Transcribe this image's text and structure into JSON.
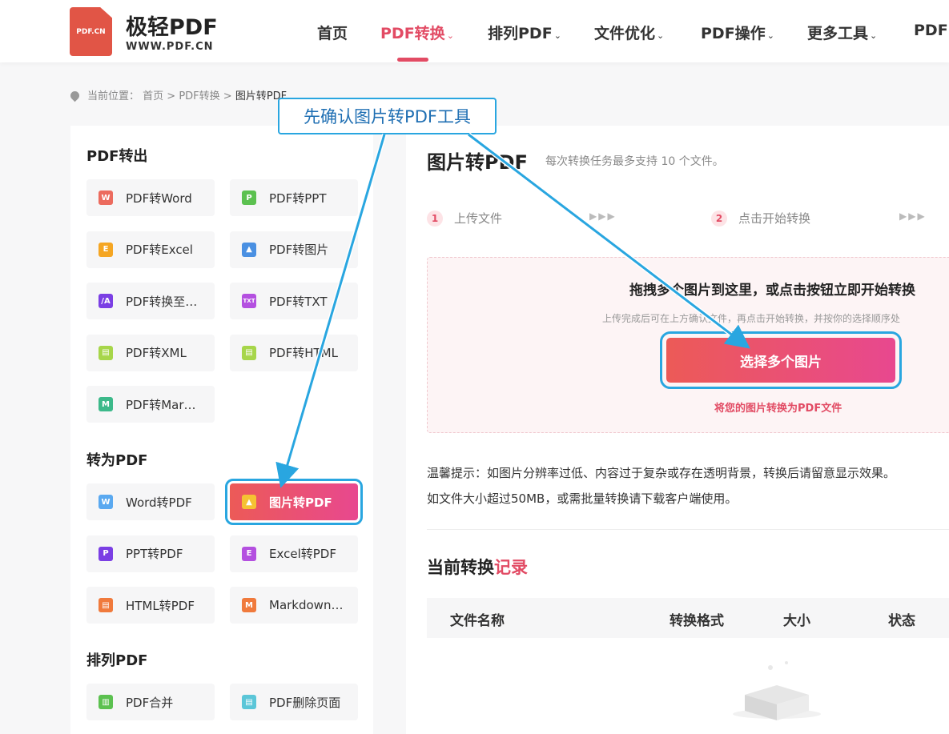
{
  "header": {
    "logo_badge": "PDF.CN",
    "logo_name": "极轻PDF",
    "logo_url": "WWW.PDF.CN",
    "nav": [
      {
        "label": "首页",
        "dropdown": false
      },
      {
        "label": "PDF转换",
        "dropdown": true,
        "active": true
      },
      {
        "label": "排列PDF",
        "dropdown": true
      },
      {
        "label": "文件优化",
        "dropdown": true
      },
      {
        "label": "PDF操作",
        "dropdown": true
      },
      {
        "label": "更多工具",
        "dropdown": true
      },
      {
        "label": "PDF",
        "dropdown": false
      }
    ],
    "accent": "#e24b64"
  },
  "breadcrumb": {
    "prefix": "当前位置：",
    "path": "首页 > PDF转换 > ",
    "current": "图片转PDF"
  },
  "sidebar": {
    "sections": [
      {
        "title": "PDF转出",
        "items": [
          {
            "label": "PDF转Word",
            "icon": "word-icon",
            "icon_text": "W",
            "color": "#ec6b5e"
          },
          {
            "label": "PDF转PPT",
            "icon": "ppt-icon",
            "icon_text": "P",
            "color": "#5cc150"
          },
          {
            "label": "PDF转Excel",
            "icon": "excel-icon",
            "icon_text": "E",
            "color": "#f5a623"
          },
          {
            "label": "PDF转图片",
            "icon": "image-icon",
            "icon_text": "▲",
            "color": "#4a90e2"
          },
          {
            "label": "PDF转换至…",
            "icon": "pdfa-icon",
            "icon_text": "/A",
            "color": "#7b3fe4"
          },
          {
            "label": "PDF转TXT",
            "icon": "txt-icon",
            "icon_text": "TXT",
            "color": "#b450e0"
          },
          {
            "label": "PDF转XML",
            "icon": "xml-icon",
            "icon_text": "▤",
            "color": "#a7d64a"
          },
          {
            "label": "PDF转HTML",
            "icon": "html-icon",
            "icon_text": "▤",
            "color": "#a7d64a"
          },
          {
            "label": "PDF转Mar…",
            "icon": "markdown-icon",
            "icon_text": "M",
            "color": "#3cb98a"
          }
        ]
      },
      {
        "title": "转为PDF",
        "items": [
          {
            "label": "Word转PDF",
            "icon": "word-icon",
            "icon_text": "W",
            "color": "#5aa9f0"
          },
          {
            "label": "图片转PDF",
            "icon": "image-icon",
            "icon_text": "▲",
            "color": "#f5c233",
            "active": true
          },
          {
            "label": "PPT转PDF",
            "icon": "ppt-icon",
            "icon_text": "P",
            "color": "#7b3fe4"
          },
          {
            "label": "Excel转PDF",
            "icon": "excel-icon",
            "icon_text": "E",
            "color": "#b450e0"
          },
          {
            "label": "HTML转PDF",
            "icon": "html-icon",
            "icon_text": "▤",
            "color": "#f07a3c"
          },
          {
            "label": "Markdown…",
            "icon": "markdown-icon",
            "icon_text": "M",
            "color": "#f07a3c"
          }
        ]
      },
      {
        "title": "排列PDF",
        "items": [
          {
            "label": "PDF合并",
            "icon": "merge-icon",
            "icon_text": "▥",
            "color": "#5cc150"
          },
          {
            "label": "PDF删除页面",
            "icon": "delete-page-icon",
            "icon_text": "▤",
            "color": "#5bc6d8"
          }
        ]
      }
    ]
  },
  "main": {
    "title": "图片转PDF",
    "subtitle": "每次转换任务最多支持 10 个文件。",
    "steps": [
      {
        "num": "1",
        "label": "上传文件"
      },
      {
        "num": "2",
        "label": "点击开始转换"
      }
    ],
    "step_arrows": "▶▶▶",
    "drop_title": "拖拽多个图片到这里，或点击按钮立即开始转换",
    "drop_hint": "上传完成后可在上方确认文件，再点击开始转换，并按你的选择顺序处",
    "select_button": "选择多个图片",
    "button_sub": "将您的图片转换为PDF文件",
    "tips": [
      "温馨提示：如图片分辨率过低、内容过于复杂或存在透明背景，转换后请留意显示效果。",
      "如文件大小超过50MB，或需批量转换请下载客户端使用。"
    ],
    "records_title_a": "当前转换",
    "records_title_b": "记录",
    "columns": [
      "文件名称",
      "转换格式",
      "大小",
      "状态"
    ]
  },
  "annotation": {
    "callout": "先确认图片转PDF工具",
    "color": "#29a6e0"
  }
}
